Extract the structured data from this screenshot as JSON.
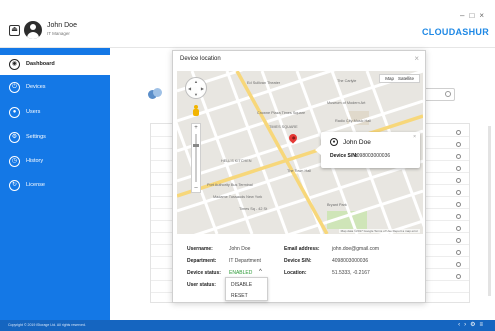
{
  "user": {
    "name": "John Doe",
    "role": "IT Manager"
  },
  "brand": {
    "name": "CLOUDASHUR",
    "color": "#1e88e5"
  },
  "window_controls": {
    "minimize": "–",
    "maximize": "□",
    "close": "×"
  },
  "sidebar": {
    "color": "#1478e6",
    "items": [
      {
        "label": "Dashboard",
        "icon": "dashboard-icon",
        "glyph": "◉"
      },
      {
        "label": "Devices",
        "icon": "devices-icon",
        "glyph": "⏻"
      },
      {
        "label": "Users",
        "icon": "users-icon",
        "glyph": "●"
      },
      {
        "label": "Settings",
        "icon": "settings-icon",
        "glyph": "⚙"
      },
      {
        "label": "History",
        "icon": "history-icon",
        "glyph": "◷"
      },
      {
        "label": "License",
        "icon": "license-icon",
        "glyph": "↻"
      }
    ]
  },
  "footer": {
    "copyright": "Copyright © 2019 iStorage Ltd. All rights reserved.",
    "icons": [
      "‹",
      "›",
      "⚙",
      "≡"
    ]
  },
  "modal": {
    "title": "Device location",
    "close": "×",
    "map": {
      "types": [
        "Map",
        "Satellite"
      ],
      "zoom_in": "+",
      "zoom_out": "–",
      "credit": "Map data ©2017 Google   Terms of Use   Report a map error",
      "labels": [
        "TIMES SQUARE",
        "Times Sq - 42 St",
        "Port Authority Bus Terminal",
        "Madame Tussauds New York",
        "Bryant Park",
        "HELL'S KITCHEN",
        "The Town Hall",
        "Crowne Plaza Times Square",
        "Ed Sullivan Theater",
        "Museum of Modern Art",
        "Radio City Music Hall",
        "The Carlyle"
      ],
      "info_window": {
        "name": "John Doe",
        "sn_label": "Device S/N:",
        "sn_value": "4098003000036",
        "close": "×"
      }
    },
    "details": {
      "username_label": "Username:",
      "username": "John Doe",
      "department_label": "Department:",
      "department": "IT Department",
      "device_status_label": "Device status:",
      "device_status": "ENABLED",
      "user_status_label": "User status:",
      "email_label": "Email address:",
      "email": "john.doe@gmail.com",
      "device_sn_label": "Device S/N:",
      "device_sn": "4098003000036",
      "location_label": "Location:",
      "location": "51.5333, -0.2167",
      "status_chevron": "^",
      "status_options": [
        "DISABLE",
        "RESET"
      ]
    }
  }
}
